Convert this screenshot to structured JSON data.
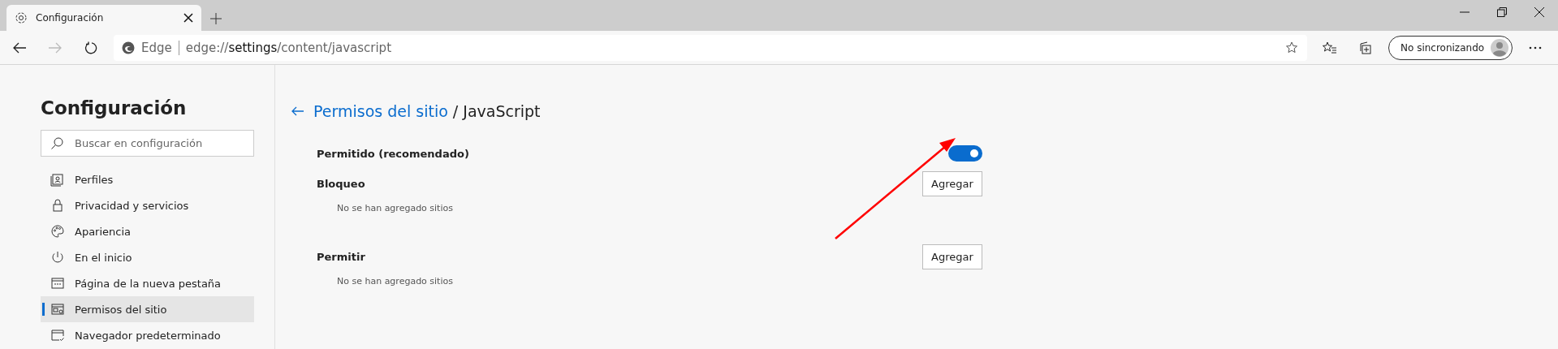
{
  "tabs": [
    {
      "title": "Configuración",
      "selected": true
    }
  ],
  "toolbar": {
    "address_scheme": "Edge",
    "address_prefix": "edge://",
    "address_host": "settings",
    "address_path": "/content/javascript",
    "profile_label": "No sincronizando"
  },
  "sidebar": {
    "title": "Configuración",
    "search": {
      "placeholder": "Buscar en configuración"
    },
    "items": [
      {
        "label": "Perfiles",
        "selected": false
      },
      {
        "label": "Privacidad y servicios",
        "selected": false
      },
      {
        "label": "Apariencia",
        "selected": false
      },
      {
        "label": "En el inicio",
        "selected": false
      },
      {
        "label": "Página de la nueva pestaña",
        "selected": false
      },
      {
        "label": "Permisos del sitio",
        "selected": true
      },
      {
        "label": "Navegador predeterminado",
        "selected": false
      }
    ]
  },
  "main": {
    "breadcrumb_link": "Permisos del sitio",
    "breadcrumb_current": " / JavaScript",
    "setting": {
      "label": "Permitido (recomendado)",
      "on": true
    },
    "sections": [
      {
        "title": "Bloqueo",
        "button": "Agregar",
        "empty_text": "No se han agregado sitios"
      },
      {
        "title": "Permitir",
        "button": "Agregar",
        "empty_text": "No se han agregado sitios"
      }
    ]
  }
}
